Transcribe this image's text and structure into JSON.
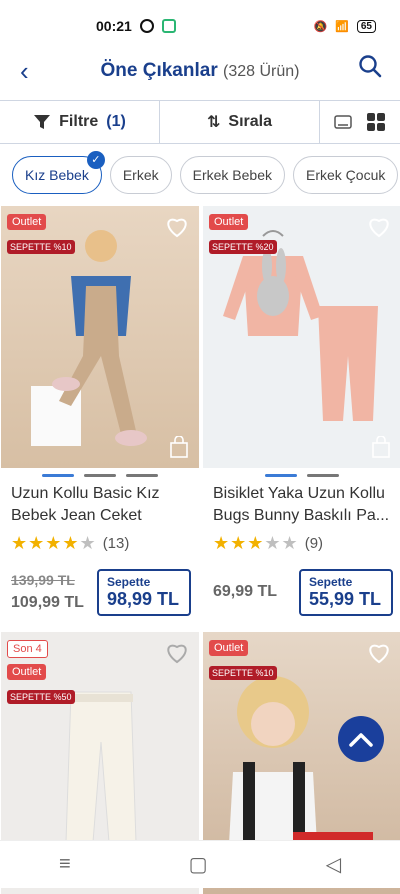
{
  "status": {
    "time": "00:21",
    "battery": "65"
  },
  "header": {
    "title": "Öne Çıkanlar",
    "count": "(328 Ürün)"
  },
  "toolbar": {
    "filter_label": "Filtre",
    "filter_count": "(1)",
    "sort_label": "Sırala"
  },
  "chips": [
    "Kız Bebek",
    "Erkek",
    "Erkek Bebek",
    "Erkek Çocuk"
  ],
  "products": [
    {
      "badges": [
        "Outlet"
      ],
      "sepette_badge": "SEPETTE %10",
      "name": "Uzun Kollu Basic Kız Bebek Jean Ceket",
      "rating": 4,
      "reviews": "(13)",
      "old_price": "139,99 TL",
      "price": "109,99 TL",
      "sepette_label": "Sepette",
      "sepette_price": "98,99 TL"
    },
    {
      "badges": [
        "Outlet"
      ],
      "sepette_badge": "SEPETTE %20",
      "name": "Bisiklet Yaka Uzun Kollu Bugs Bunny Baskılı Pa...",
      "rating": 3,
      "reviews": "(9)",
      "price": "69,99 TL",
      "sepette_label": "Sepette",
      "sepette_price": "55,99 TL"
    },
    {
      "badges": [
        "Son 4",
        "Outlet"
      ],
      "sepette_badge": "SEPETTE %50"
    },
    {
      "badges": [
        "Outlet"
      ],
      "sepette_badge": "SEPETTE %10"
    }
  ],
  "colors": {
    "brand": "#1a3f8c",
    "outlet": "#e24b4b",
    "sepette": "#b01c28",
    "star": "#f2b100"
  }
}
